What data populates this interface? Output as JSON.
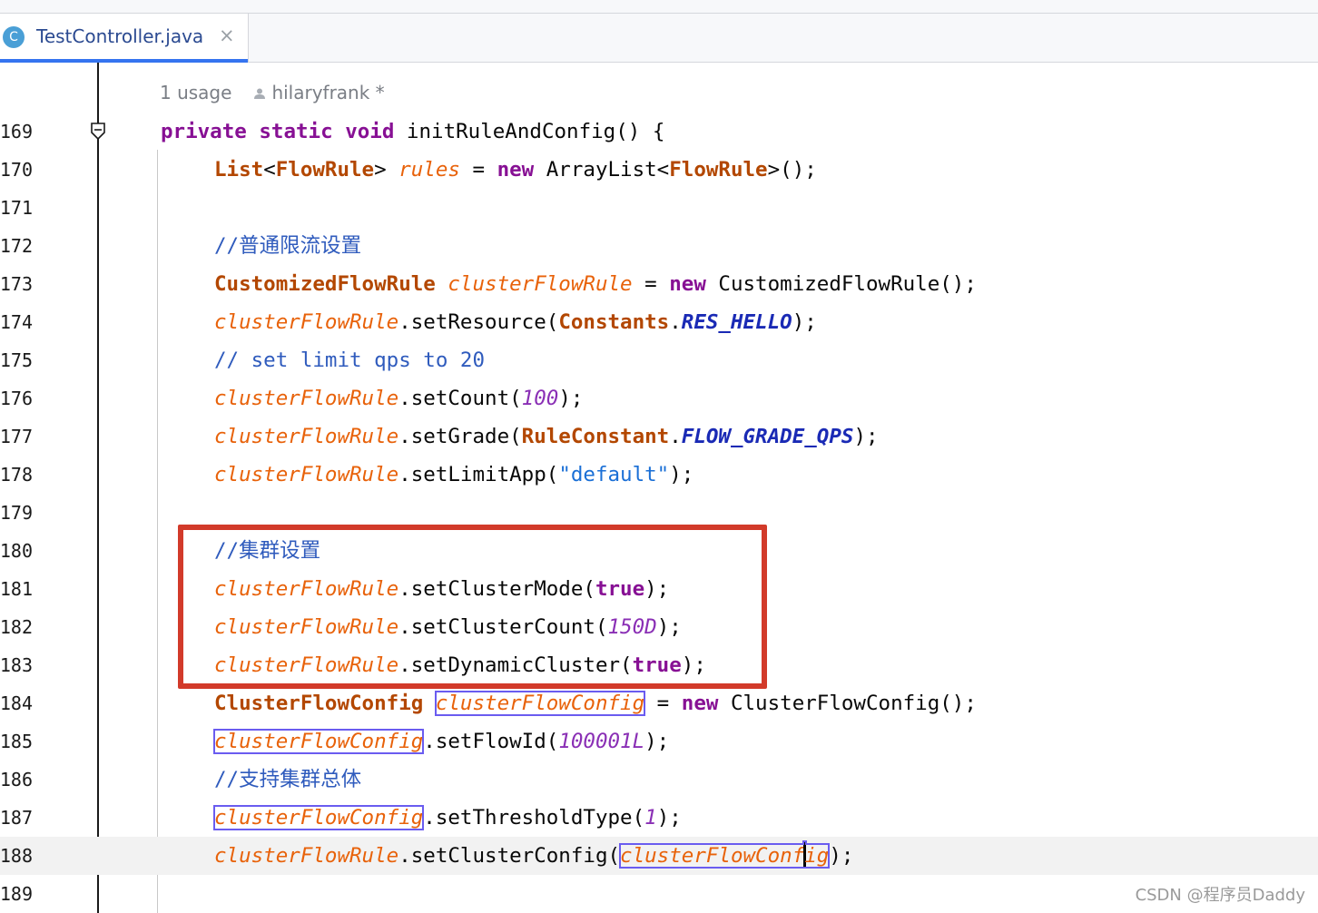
{
  "tab": {
    "icon_letter": "C",
    "title": "TestController.java",
    "close": "×"
  },
  "hint": {
    "usages": "1 usage",
    "author": "hilaryfrank *"
  },
  "lines": [
    {
      "n": "169"
    },
    {
      "n": "170"
    },
    {
      "n": "171"
    },
    {
      "n": "172"
    },
    {
      "n": "173"
    },
    {
      "n": "174"
    },
    {
      "n": "175"
    },
    {
      "n": "176"
    },
    {
      "n": "177"
    },
    {
      "n": "178"
    },
    {
      "n": "179"
    },
    {
      "n": "180"
    },
    {
      "n": "181"
    },
    {
      "n": "182"
    },
    {
      "n": "183"
    },
    {
      "n": "184"
    },
    {
      "n": "185"
    },
    {
      "n": "186"
    },
    {
      "n": "187"
    },
    {
      "n": "188"
    },
    {
      "n": "189"
    }
  ],
  "code": {
    "l169": {
      "a": "private",
      "b": "static",
      "c": "void",
      "d": " initRuleAndConfig() {"
    },
    "l170": {
      "a": "List",
      "b": "<",
      "c": "FlowRule",
      "d": "> ",
      "e": "rules",
      "f": " = ",
      "g": "new",
      "h": " ArrayList<",
      "i": "FlowRule",
      "j": ">();"
    },
    "l172": {
      "a": "//普通限流设置"
    },
    "l173": {
      "a": "CustomizedFlowRule",
      "b": "clusterFlowRule",
      "c": " = ",
      "d": "new",
      "e": " CustomizedFlowRule();"
    },
    "l174": {
      "a": "clusterFlowRule",
      "b": ".setResource(",
      "c": "Constants",
      "d": ".",
      "e": "RES_HELLO",
      "f": ");"
    },
    "l175": {
      "a": "// set limit qps to 20"
    },
    "l176": {
      "a": "clusterFlowRule",
      "b": ".setCount(",
      "c": "100",
      "d": ");"
    },
    "l177": {
      "a": "clusterFlowRule",
      "b": ".setGrade(",
      "c": "RuleConstant",
      "d": ".",
      "e": "FLOW_GRADE_QPS",
      "f": ");"
    },
    "l178": {
      "a": "clusterFlowRule",
      "b": ".setLimitApp(",
      "c": "\"default\"",
      "d": ");"
    },
    "l180": {
      "a": "//集群设置"
    },
    "l181": {
      "a": "clusterFlowRule",
      "b": ".setClusterMode(",
      "c": "true",
      "d": ");"
    },
    "l182": {
      "a": "clusterFlowRule",
      "b": ".setClusterCount(",
      "c": "150D",
      "d": ");"
    },
    "l183": {
      "a": "clusterFlowRule",
      "b": ".setDynamicCluster(",
      "c": "true",
      "d": ");"
    },
    "l184": {
      "a": "ClusterFlowConfig",
      "b": "clusterFlowConfig",
      "c": " = ",
      "d": "new",
      "e": " ClusterFlowConfig();"
    },
    "l185": {
      "a": "clusterFlowConfig",
      "b": ".setFlowId(",
      "c": "100001L",
      "d": ");"
    },
    "l186": {
      "a": "//支持集群总体"
    },
    "l187": {
      "a": "clusterFlowConfig",
      "b": ".setThresholdType(",
      "c": "1",
      "d": ");"
    },
    "l188": {
      "a": "clusterFlowRule",
      "b": ".setClusterConfig(",
      "c1": "clusterFlowConf",
      "c2": "ig",
      "d": ");"
    }
  },
  "watermark": "CSDN @程序员Daddy",
  "colors": {
    "keyword": "#0033b3",
    "field": "#e8620a",
    "comment": "#2f5bbd",
    "highlight_box": "#d23a2a",
    "usage_box": "#6a5cf0"
  }
}
